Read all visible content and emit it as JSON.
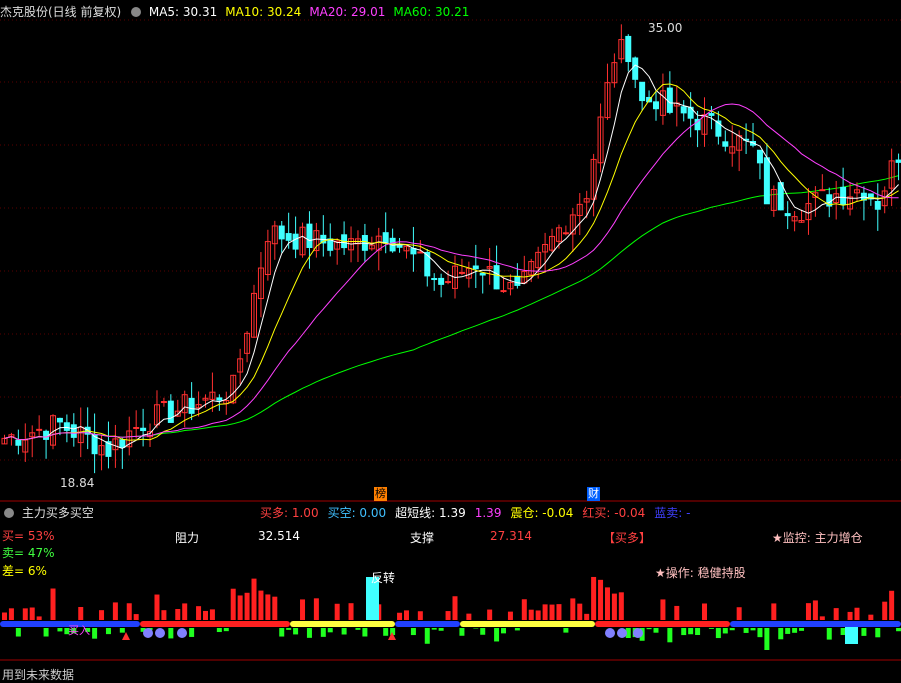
{
  "header": {
    "title": "杰克股份(日线 前复权)",
    "ma": [
      {
        "label": "MA5: 30.31",
        "color": "#ffffff"
      },
      {
        "label": "MA10: 30.24",
        "color": "#ffff00"
      },
      {
        "label": "MA20: 29.01",
        "color": "#ff40ff"
      },
      {
        "label": "MA60: 30.21",
        "color": "#00ff00"
      }
    ]
  },
  "price_chart": {
    "high_label": "35.00",
    "low_label": "18.84",
    "markers": [
      {
        "text": "榜",
        "bg": "#ff8000",
        "color": "#000000"
      },
      {
        "text": "财",
        "bg": "#0060ff",
        "color": "#ffffff"
      }
    ]
  },
  "indicator": {
    "title": "主力买多买空",
    "values": [
      {
        "label": "买多: 1.00",
        "color": "#ff4040"
      },
      {
        "label": "买空: 0.00",
        "color": "#40c0ff"
      },
      {
        "label": "超短线: 1.39",
        "color": "#ffffff"
      },
      {
        "label": "1.39",
        "color": "#ff40ff"
      },
      {
        "label": "震仓: -0.04",
        "color": "#ffff00"
      },
      {
        "label": "红买: -0.04",
        "color": "#ff4040"
      },
      {
        "label": "蓝卖: -",
        "color": "#4040ff"
      }
    ],
    "buy_pct": "买= 53%",
    "sell_pct": "卖= 47%",
    "diff_pct": "差= 6%",
    "resistance_label": "阻力",
    "resistance_value": "32.514",
    "support_label": "支撑",
    "support_value": "27.314",
    "bracket_label": "【买多】",
    "monitor_text": "★监控: 主力增仓",
    "operation_text": "★操作: 稳健持股",
    "reversal_label": "反转",
    "buy_in_label": "买入"
  },
  "footer": {
    "text": "用到未来数据"
  },
  "chart_data": {
    "type": "candlestick",
    "series_name": "杰克股份",
    "price_range": [
      18.84,
      35.0
    ],
    "moving_averages": [
      "MA5",
      "MA10",
      "MA20",
      "MA60"
    ],
    "latest_values": {
      "MA5": 30.31,
      "MA10": 30.24,
      "MA20": 29.01,
      "MA60": 30.21
    },
    "high": 35.0,
    "low": 18.84,
    "resistance": 32.514,
    "support": 27.314
  }
}
